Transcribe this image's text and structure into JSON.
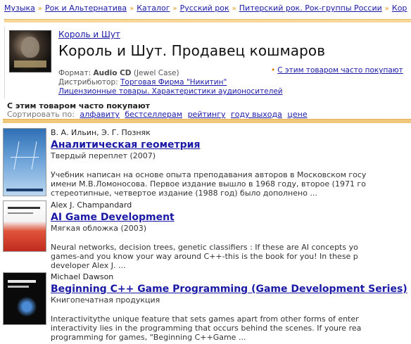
{
  "breadcrumb": [
    "Музыка",
    "Рок и Альтернатива",
    "Каталог",
    "Русский рок",
    "Питерский рок. Рок-группы России",
    "Кор"
  ],
  "product": {
    "artist": "Король и Шут",
    "title": "Король и Шут. Продавец кошмаров",
    "format_label": "Формат:",
    "format_value": "Audio CD",
    "format_note": "(Jewel Case)",
    "distributor_label": "Дистрибьютор:",
    "distributor_value": "Торговая Фирма \"Никитин\"",
    "license_link": "Лицензионные товары. Характеристики аудионосителей",
    "also_bought_link": "С этим товаром часто покупают"
  },
  "also_bought": {
    "title": "С этим товаром часто покупают",
    "sort_label": "Сортировать по:",
    "sort_options": [
      "алфавиту",
      "бестселлерам",
      "рейтингу",
      "году выхода",
      "цене"
    ]
  },
  "books": [
    {
      "author": "В. А. Ильин, Э. Г. Позняк",
      "title": "Аналитическая геометрия",
      "format": "Твердый переплет (2007)",
      "desc": [
        "Учебник написан на основе опыта преподавания авторов в Московском госу",
        "имени М.В.Ломоносова. Первое издание вышло в 1968 году, второе (1971 го",
        "стереотипные, четвертое издание (1988 год) было дополнено ..."
      ]
    },
    {
      "author": "Alex J. Champandard",
      "title": "AI Game Development",
      "format": "Мягкая обложка (2003)",
      "desc": [
        "Neural networks, decision trees, genetic classifiers : If these are AI concepts yo",
        "games-and you know your way around C++-this is the book for you! In these p",
        "developer Alex J. ..."
      ]
    },
    {
      "author": "Michael Dawson",
      "title": "Beginning C++ Game Programming (Game Development Series)",
      "format": "Книгопечатная продукция",
      "desc": [
        "Interactivitythe unique feature that sets games apart from other forms of enter",
        "interactivity lies in the programming that occurs behind the scenes. If youre rea",
        "programming for games, \"Beginning C++Game ..."
      ]
    }
  ]
}
